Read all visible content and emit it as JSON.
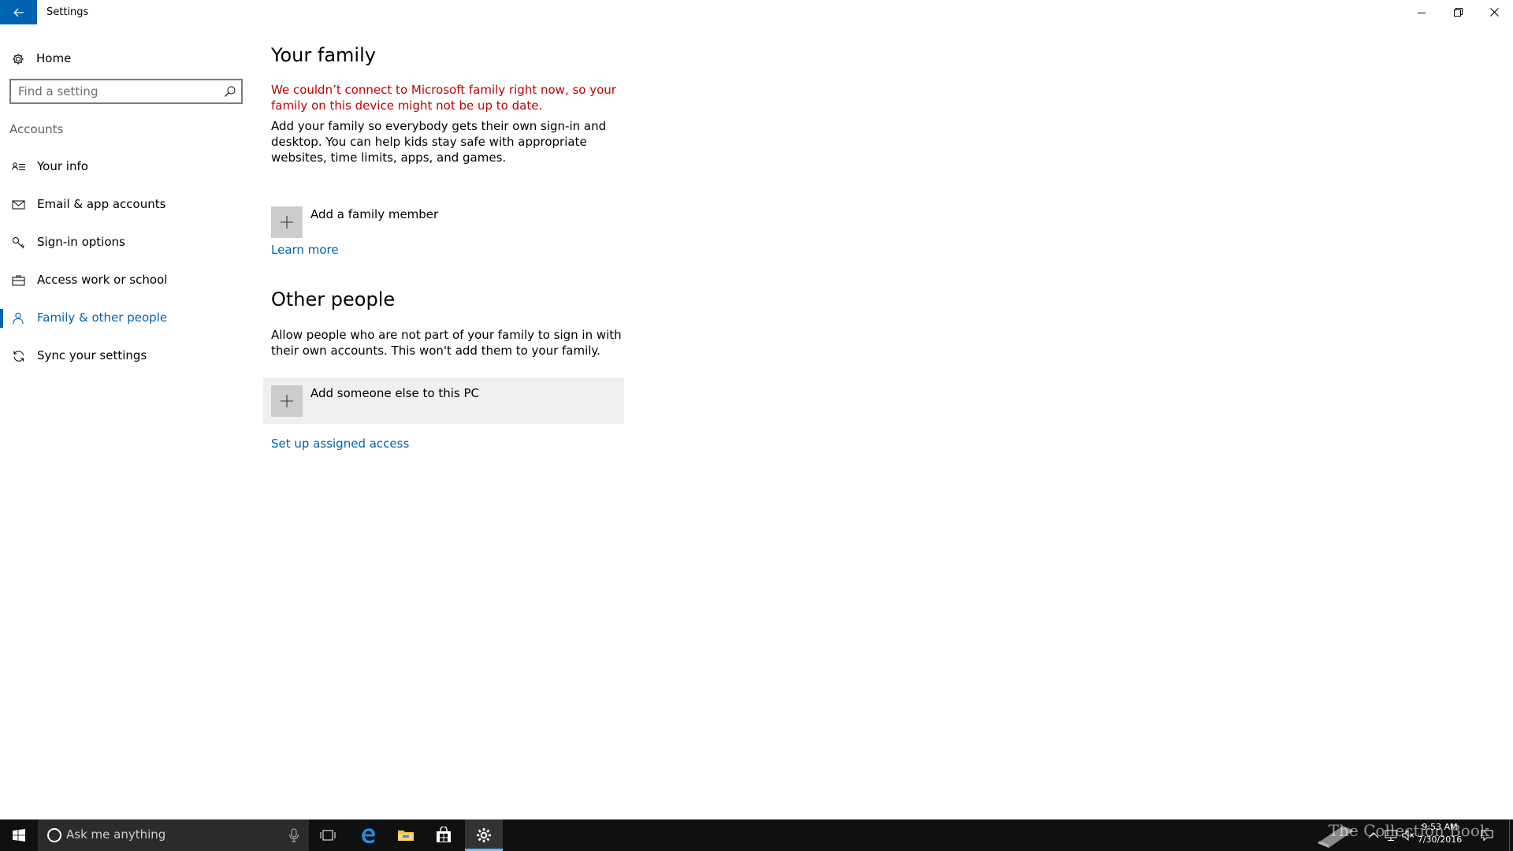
{
  "window": {
    "title": "Settings"
  },
  "sidebar": {
    "home_label": "Home",
    "search_placeholder": "Find a setting",
    "section_label": "Accounts",
    "items": [
      {
        "label": "Your info",
        "icon": "person-card-icon"
      },
      {
        "label": "Email & app accounts",
        "icon": "mail-icon"
      },
      {
        "label": "Sign-in options",
        "icon": "key-icon"
      },
      {
        "label": "Access work or school",
        "icon": "briefcase-icon"
      },
      {
        "label": "Family & other people",
        "icon": "person-icon",
        "active": true
      },
      {
        "label": "Sync your settings",
        "icon": "sync-icon"
      }
    ]
  },
  "main": {
    "family": {
      "heading": "Your family",
      "error": "We couldn’t connect to Microsoft family right now, so your family on this device might not be up to date.",
      "description": "Add your family so everybody gets their own sign-in and desktop. You can help kids stay safe with appropriate websites, time limits, apps, and games.",
      "add_label": "Add a family member",
      "learn_more": "Learn more"
    },
    "others": {
      "heading": "Other people",
      "description": "Allow people who are not part of your family to sign in with their own accounts. This won't add them to your family.",
      "add_label": "Add someone else to this PC",
      "assigned_access": "Set up assigned access"
    }
  },
  "taskbar": {
    "search_placeholder": "Ask me anything",
    "time": "9:53 AM",
    "date": "7/30/2016",
    "watermark": "The Collection Book"
  },
  "colors": {
    "accent": "#0063b1",
    "error": "#c00000",
    "taskbar": "#101010"
  }
}
